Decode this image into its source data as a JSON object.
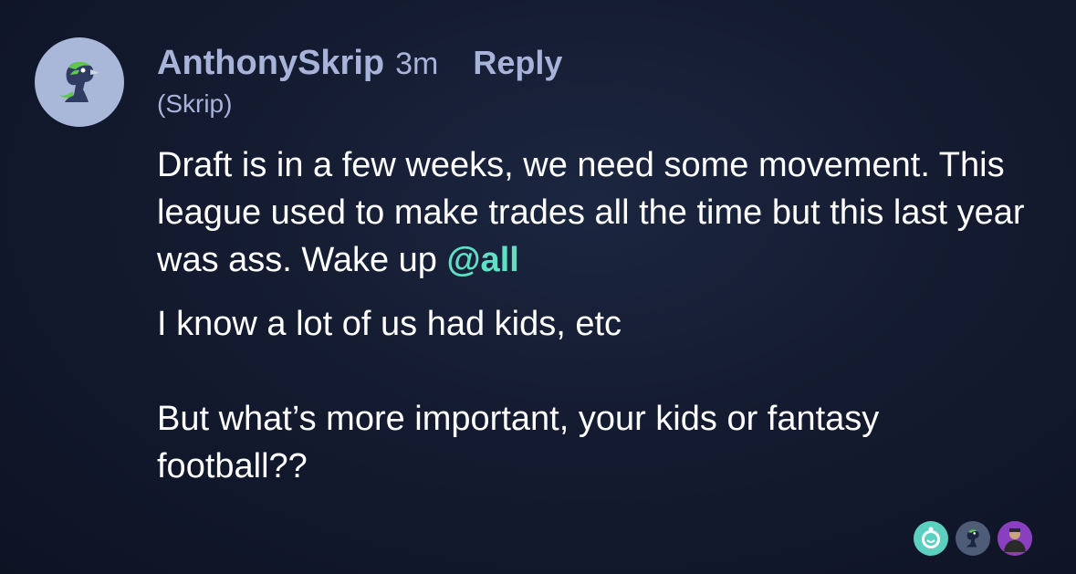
{
  "comment": {
    "username": "AnthonySkrip",
    "timestamp": "3m",
    "reply_label": "Reply",
    "nickname": "(Skrip)",
    "message": {
      "line_1_prefix": "Draft is in a few weeks, we need some movement. This league used to make trades all the time but this last year was ass. Wake up ",
      "mention": "@all",
      "paragraph_2": "I know a lot of us had kids, etc",
      "paragraph_3": "But what’s more important, your kids or fantasy football??"
    },
    "avatar_icon": "seahawk-mascot-icon",
    "reactions": [
      {
        "icon": "mascot-avatar-icon",
        "color": "#5ccfc0"
      },
      {
        "icon": "seahawk-mascot-icon",
        "color": "#4f5c78"
      },
      {
        "icon": "person-photo-icon",
        "color": "#8a3fbf"
      }
    ]
  },
  "colors": {
    "name_color": "#a7b3d9",
    "mention_color": "#5fe0c4",
    "text_color": "#ffffff",
    "avatar_bg": "#a9b8d8"
  }
}
